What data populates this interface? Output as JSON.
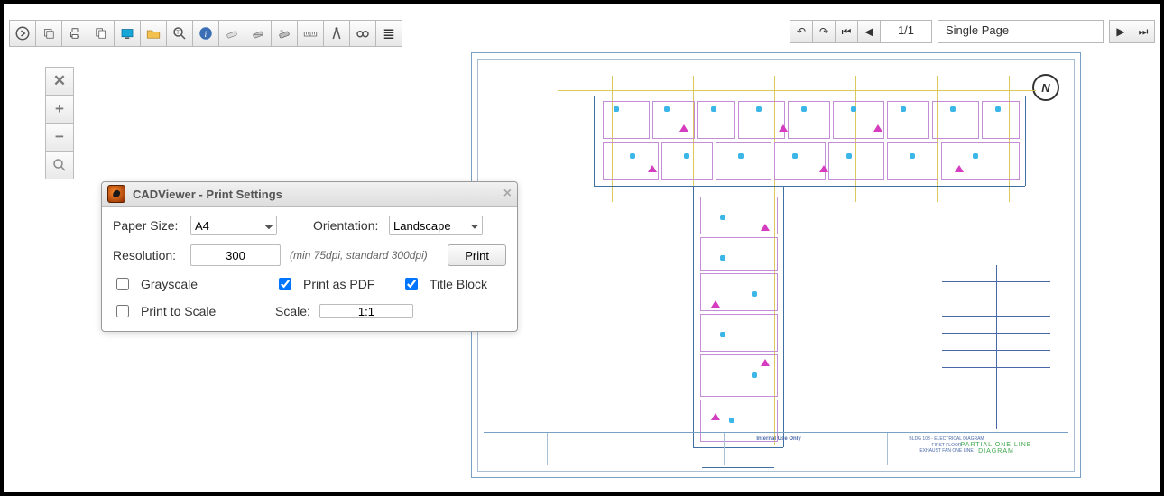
{
  "toolbar_icons": [
    "arrow-next-icon",
    "layers-icon",
    "print-icon",
    "copy-multi-icon",
    "screen-icon",
    "folder-open-icon",
    "zoom-text-icon",
    "info-icon",
    "eraser1-icon",
    "eraser2-icon",
    "eraser3-icon",
    "tape-measure-icon",
    "compass-icon",
    "glasses-icon",
    "list-icon"
  ],
  "pagebar": {
    "undo_icon": "undo-icon",
    "redo_icon": "redo-icon",
    "first_icon": "first-page-icon",
    "prev_icon": "prev-page-icon",
    "page_indicator": "1/1",
    "view_mode": "Single Page",
    "next_icon": "next-page-icon",
    "last_icon": "last-page-icon"
  },
  "zoom_icons": [
    "zoom-extents-icon",
    "zoom-in-icon",
    "zoom-out-icon",
    "zoom-window-icon"
  ],
  "drawing": {
    "north_letter": "N",
    "titleblock": {
      "internal_use": "Internal Use Only",
      "line1": "BLDG 103 - ELECTRICAL DIAGRAM",
      "line2": "FIRST FLOOR",
      "line3": "EXHAUST FAN ONE LINE"
    },
    "legend_title": "PARTIAL ONE LINE DIAGRAM"
  },
  "dialog": {
    "title": "CADViewer - Print Settings",
    "paper_size_label": "Paper Size:",
    "paper_size_value": "A4",
    "orientation_label": "Orientation:",
    "orientation_value": "Landscape",
    "resolution_label": "Resolution:",
    "resolution_value": "300",
    "resolution_hint": "(min 75dpi, standard 300dpi)",
    "print_button": "Print",
    "grayscale_label": "Grayscale",
    "grayscale_checked": false,
    "print_as_pdf_label": "Print as PDF",
    "print_as_pdf_checked": true,
    "title_block_label": "Title Block",
    "title_block_checked": true,
    "print_to_scale_label": "Print to Scale",
    "print_to_scale_checked": false,
    "scale_label": "Scale:",
    "scale_value": "1:1"
  }
}
